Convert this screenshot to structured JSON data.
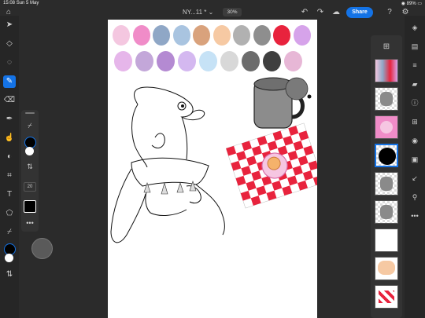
{
  "status": {
    "time": "15:08",
    "date": "Sun 5 May",
    "battery": "89%"
  },
  "document": {
    "title": "NY...11 *",
    "zoom": "30%"
  },
  "toolbar": {
    "share_label": "Share"
  },
  "brush_panel": {
    "size_value": "20"
  },
  "swatches_row1": [
    "#f4c7e0",
    "#f08cc8",
    "#8fa7c6",
    "#a9c4e0",
    "#d9a27c",
    "#f6c9a3",
    "#b1b1b1",
    "#8e8e8e",
    "#e8233d",
    "#d6a3ea"
  ],
  "swatches_row2": [
    "#e6b6ea",
    "#c3a7d9",
    "#b48ad2",
    "#d4b8f0",
    "#c6e2f6",
    "#d8d8d8",
    "#6c6c6c",
    "#3f3f3f",
    "#e7b7d6"
  ],
  "colors": {
    "accent": "#1473e6",
    "checker_red": "#e8233d"
  },
  "layers": [
    "swatches",
    "mug",
    "plate",
    "black-fill",
    "dino-shadow-1",
    "dino-shadow-2",
    "sketch",
    "peach-blob",
    "checker"
  ]
}
